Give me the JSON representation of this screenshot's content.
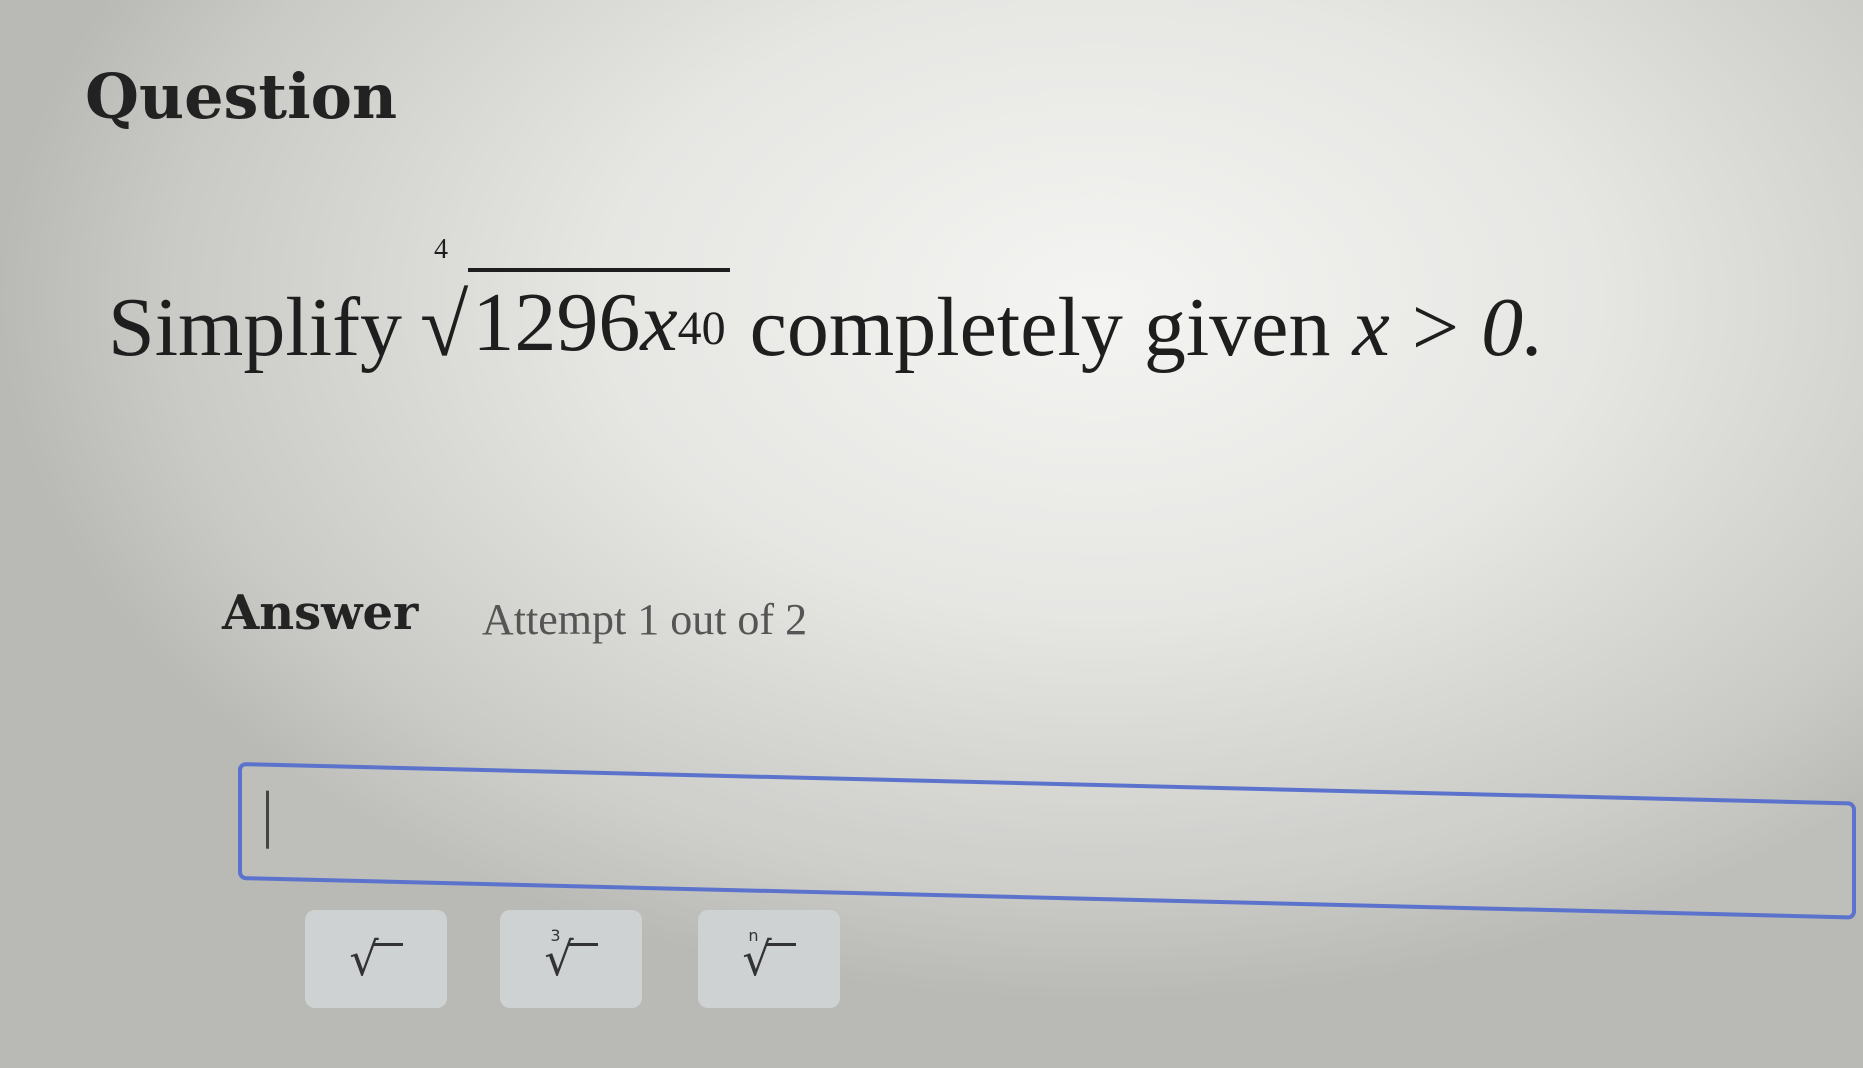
{
  "question": {
    "title": "Question",
    "prompt_prefix": "Simplify",
    "radical_index": "4",
    "radicand_coefficient": "1296",
    "radicand_variable": "x",
    "radicand_exponent": "40",
    "prompt_middle": "completely given",
    "condition_variable": "x",
    "condition_operator": ">",
    "condition_value": "0."
  },
  "answer": {
    "label": "Answer",
    "attempt_text": "Attempt 1 out of 2",
    "input_value": ""
  },
  "toolbar": {
    "buttons": [
      {
        "name": "square-root",
        "index": ""
      },
      {
        "name": "cube-root",
        "index": "3"
      },
      {
        "name": "nth-root",
        "index": "n"
      }
    ]
  },
  "colors": {
    "accent": "#5b73cc",
    "button_bg": "#cfd2d3"
  }
}
